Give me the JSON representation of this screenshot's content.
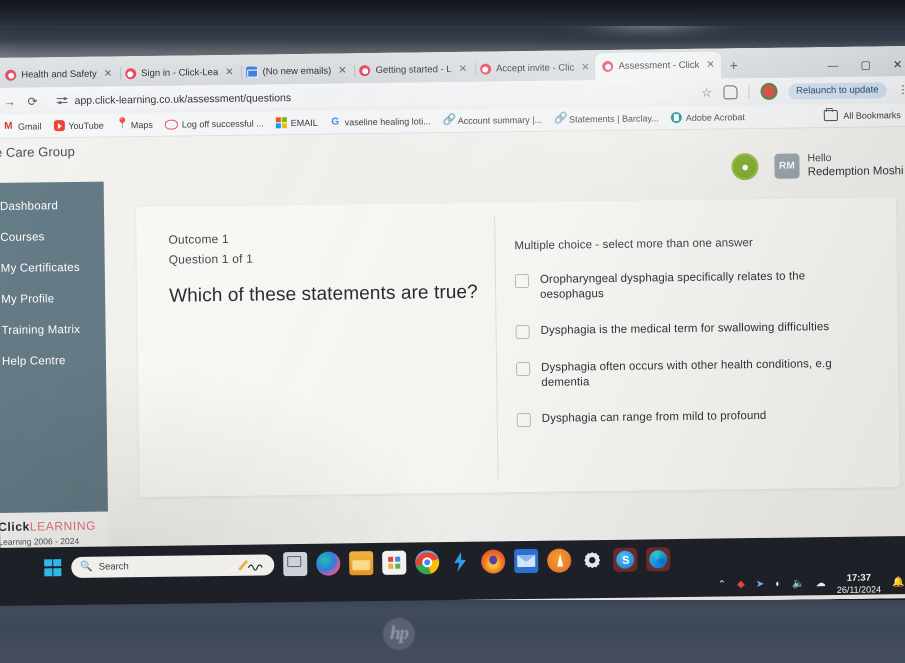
{
  "browser": {
    "tabs": [
      {
        "title": "Health and Safety",
        "icon": "clicklearning-favicon",
        "active": false
      },
      {
        "title": "Sign in - Click-Lea",
        "icon": "clicklearning-favicon",
        "active": false
      },
      {
        "title": "(No new emails)",
        "icon": "mail-favicon",
        "active": false
      },
      {
        "title": "Getting started - L",
        "icon": "clicklearning-favicon",
        "active": false
      },
      {
        "title": "Accept invite - Clic",
        "icon": "clicklearning-favicon",
        "active": false
      },
      {
        "title": "Assessment - Click",
        "icon": "clicklearning-favicon",
        "active": true
      }
    ],
    "new_tab_label": "+",
    "window_controls": {
      "minimize": "—",
      "maximize": "▢",
      "close": "✕"
    },
    "nav": {
      "forward": "→",
      "reload": "⟳"
    },
    "address": "app.click-learning.co.uk/assessment/questions",
    "relaunch_label": "Relaunch to update",
    "kebab_label": "⋮",
    "bookmarks": [
      {
        "label": "Gmail",
        "icon": "gmail-icon"
      },
      {
        "label": "YouTube",
        "icon": "youtube-icon"
      },
      {
        "label": "Maps",
        "icon": "maps-pin-icon"
      },
      {
        "label": "Log off successful ...",
        "icon": "eye-icon"
      },
      {
        "label": "EMAIL",
        "icon": "microsoft-icon"
      },
      {
        "label": "vaseline healing loti...",
        "icon": "google-icon"
      },
      {
        "label": "Account summary |...",
        "icon": "link-icon"
      },
      {
        "label": "Statements | Barclay...",
        "icon": "link-icon"
      },
      {
        "label": "Adobe Acrobat",
        "icon": "adobe-acrobat-icon"
      }
    ],
    "all_bookmarks_label": "All Bookmarks"
  },
  "page": {
    "org_title": "vate Care Group",
    "user": {
      "greeting": "Hello",
      "name": "Redemption Moshi",
      "initials": "RM",
      "accessibility_icon": "accessibility-icon"
    },
    "sidebar": {
      "items": [
        {
          "label": "Dashboard"
        },
        {
          "label": "Courses"
        },
        {
          "label": "My Certificates"
        },
        {
          "label": "My Profile"
        },
        {
          "label": "Training Matrix"
        },
        {
          "label": "Help Centre"
        }
      ],
      "brand_primary": "Click",
      "brand_secondary": "LEARNING",
      "copyright": "Learning 2006 - 2024"
    },
    "question": {
      "outcome": "Outcome 1",
      "counter": "Question 1 of 1",
      "text": "Which of these statements are true?",
      "type_hint": "Multiple choice - select more than one answer",
      "options": [
        {
          "label": "Oropharyngeal dysphagia specifically relates to the oesophagus",
          "checked": false
        },
        {
          "label": "Dysphagia is the medical term for swallowing difficulties",
          "checked": false
        },
        {
          "label": "Dysphagia often occurs with other health conditions, e.g dementia",
          "checked": false
        },
        {
          "label": "Dysphagia can range from mild to profound",
          "checked": false
        }
      ]
    }
  },
  "taskbar": {
    "search_placeholder": "Search",
    "start_icon": "windows-start-icon",
    "apps": [
      {
        "name": "task-view-icon"
      },
      {
        "name": "copilot-icon"
      },
      {
        "name": "file-explorer-icon"
      },
      {
        "name": "microsoft-store-icon"
      },
      {
        "name": "google-chrome-icon"
      },
      {
        "name": "shortcut-icon"
      },
      {
        "name": "firefox-icon"
      },
      {
        "name": "outlook-icon"
      },
      {
        "name": "avast-icon"
      },
      {
        "name": "settings-icon"
      },
      {
        "name": "skype-icon"
      },
      {
        "name": "microsoft-edge-icon"
      }
    ],
    "tray": {
      "chevron": "⌃",
      "icons": [
        "dropbox-icon",
        "location-icon",
        "wifi-icon",
        "volume-icon",
        "onedrive-icon"
      ],
      "time": "17:37",
      "date": "26/11/2024",
      "notification_icon": "bell-icon"
    }
  },
  "hardware": {
    "brand_logo": "hp"
  },
  "colors": {
    "sidebar_bg": "#5f7681",
    "accent_pink": "#e86e7e",
    "page_bg": "#f3f2ee",
    "card_bg": "#faf9f5",
    "relaunch_bg": "#cfe0f3"
  }
}
